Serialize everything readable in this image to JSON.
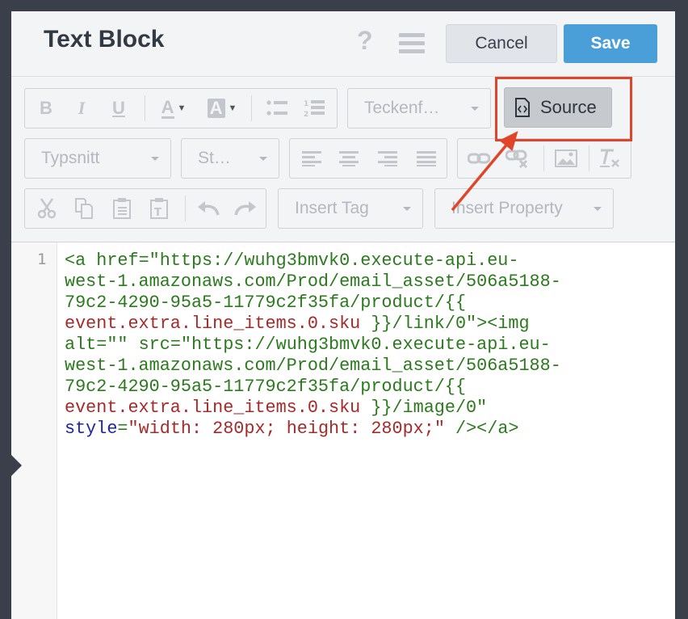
{
  "header": {
    "title": "Text Block",
    "help_icon": "?",
    "cancel_label": "Cancel",
    "save_label": "Save"
  },
  "toolbar": {
    "row1": {
      "bold": "B",
      "italic": "I",
      "underline": "U",
      "font_color": "A",
      "bg_color": "A",
      "font_name_dropdown": "Teckenf…",
      "source_label": "Source"
    },
    "row2": {
      "font_dropdown": "Typsnitt",
      "size_dropdown": "St…"
    },
    "row3": {
      "insert_tag": "Insert Tag",
      "insert_property": "Insert Property"
    }
  },
  "editor": {
    "line_number": "1",
    "lines": [
      {
        "parts": [
          [
            "tag",
            "<a "
          ],
          [
            "attr",
            "href="
          ],
          [
            "str",
            "\"https://wuhg3bmvk0.execute-api.eu-"
          ]
        ]
      },
      {
        "parts": [
          [
            "str",
            "west-1.amazonaws.com/Prod/email_asset/506a5188-"
          ]
        ]
      },
      {
        "parts": [
          [
            "str",
            "79c2-4290-95a5-11779c2f35fa/product/{{"
          ]
        ]
      },
      {
        "parts": [
          [
            "red",
            "event.extra.line_items.0.sku"
          ],
          [
            "str",
            " }}/link/0\""
          ],
          [
            "tag",
            "><img"
          ]
        ]
      },
      {
        "parts": [
          [
            "attr",
            "alt="
          ],
          [
            "str",
            "\"\""
          ],
          [
            "attr",
            " src="
          ],
          [
            "str",
            "\"https://wuhg3bmvk0.execute-api.eu-"
          ]
        ]
      },
      {
        "parts": [
          [
            "str",
            "west-1.amazonaws.com/Prod/email_asset/506a5188-"
          ]
        ]
      },
      {
        "parts": [
          [
            "str",
            "79c2-4290-95a5-11779c2f35fa/product/{{"
          ]
        ]
      },
      {
        "parts": [
          [
            "red",
            "event.extra.line_items.0.sku"
          ],
          [
            "str",
            " }}/image/0\""
          ]
        ]
      },
      {
        "parts": [
          [
            "kw",
            "style"
          ],
          [
            "attr",
            "="
          ],
          [
            "redstr",
            "\"width: 280px; height: 280px;\""
          ],
          [
            "tag",
            " /></a>"
          ]
        ]
      }
    ]
  },
  "colors": {
    "save": "#4b9fd9",
    "highlight": "#e0452a",
    "code_green": "#2b7a1e",
    "code_red": "#a52a2a",
    "code_blue": "#1e24a8"
  }
}
